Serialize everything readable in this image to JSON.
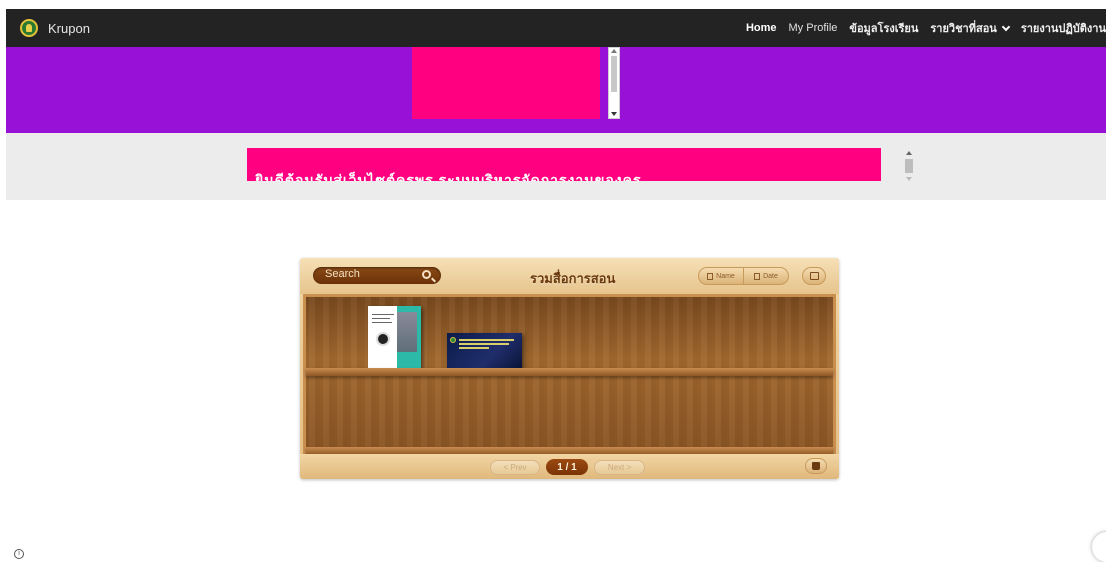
{
  "brand": {
    "name": "Krupon"
  },
  "nav": {
    "items": [
      {
        "label": "Home"
      },
      {
        "label": "My Profile"
      },
      {
        "label": "ข้อมูลโรงเรียน"
      },
      {
        "label": "รายวิชาที่สอน"
      },
      {
        "label": "รายงานปฏิบัติงาน"
      }
    ]
  },
  "marquee": {
    "text": "ยินดีต้อนรับสู่เว็บไซต์ครูพร ระบบบริหารจัดการงานของครู"
  },
  "bookshelf": {
    "search_label": "Search",
    "title": "รวมสื่อการสอน",
    "sort_name": "Name",
    "sort_date": "Date",
    "prev_label": "< Prev",
    "page_indicator": "1 / 1",
    "next_label": "Next >"
  },
  "colors": {
    "nav_bg": "#232323",
    "banner_purple": "#9711d6",
    "accent_pink": "#ff0080",
    "band_gray": "#ececec"
  }
}
